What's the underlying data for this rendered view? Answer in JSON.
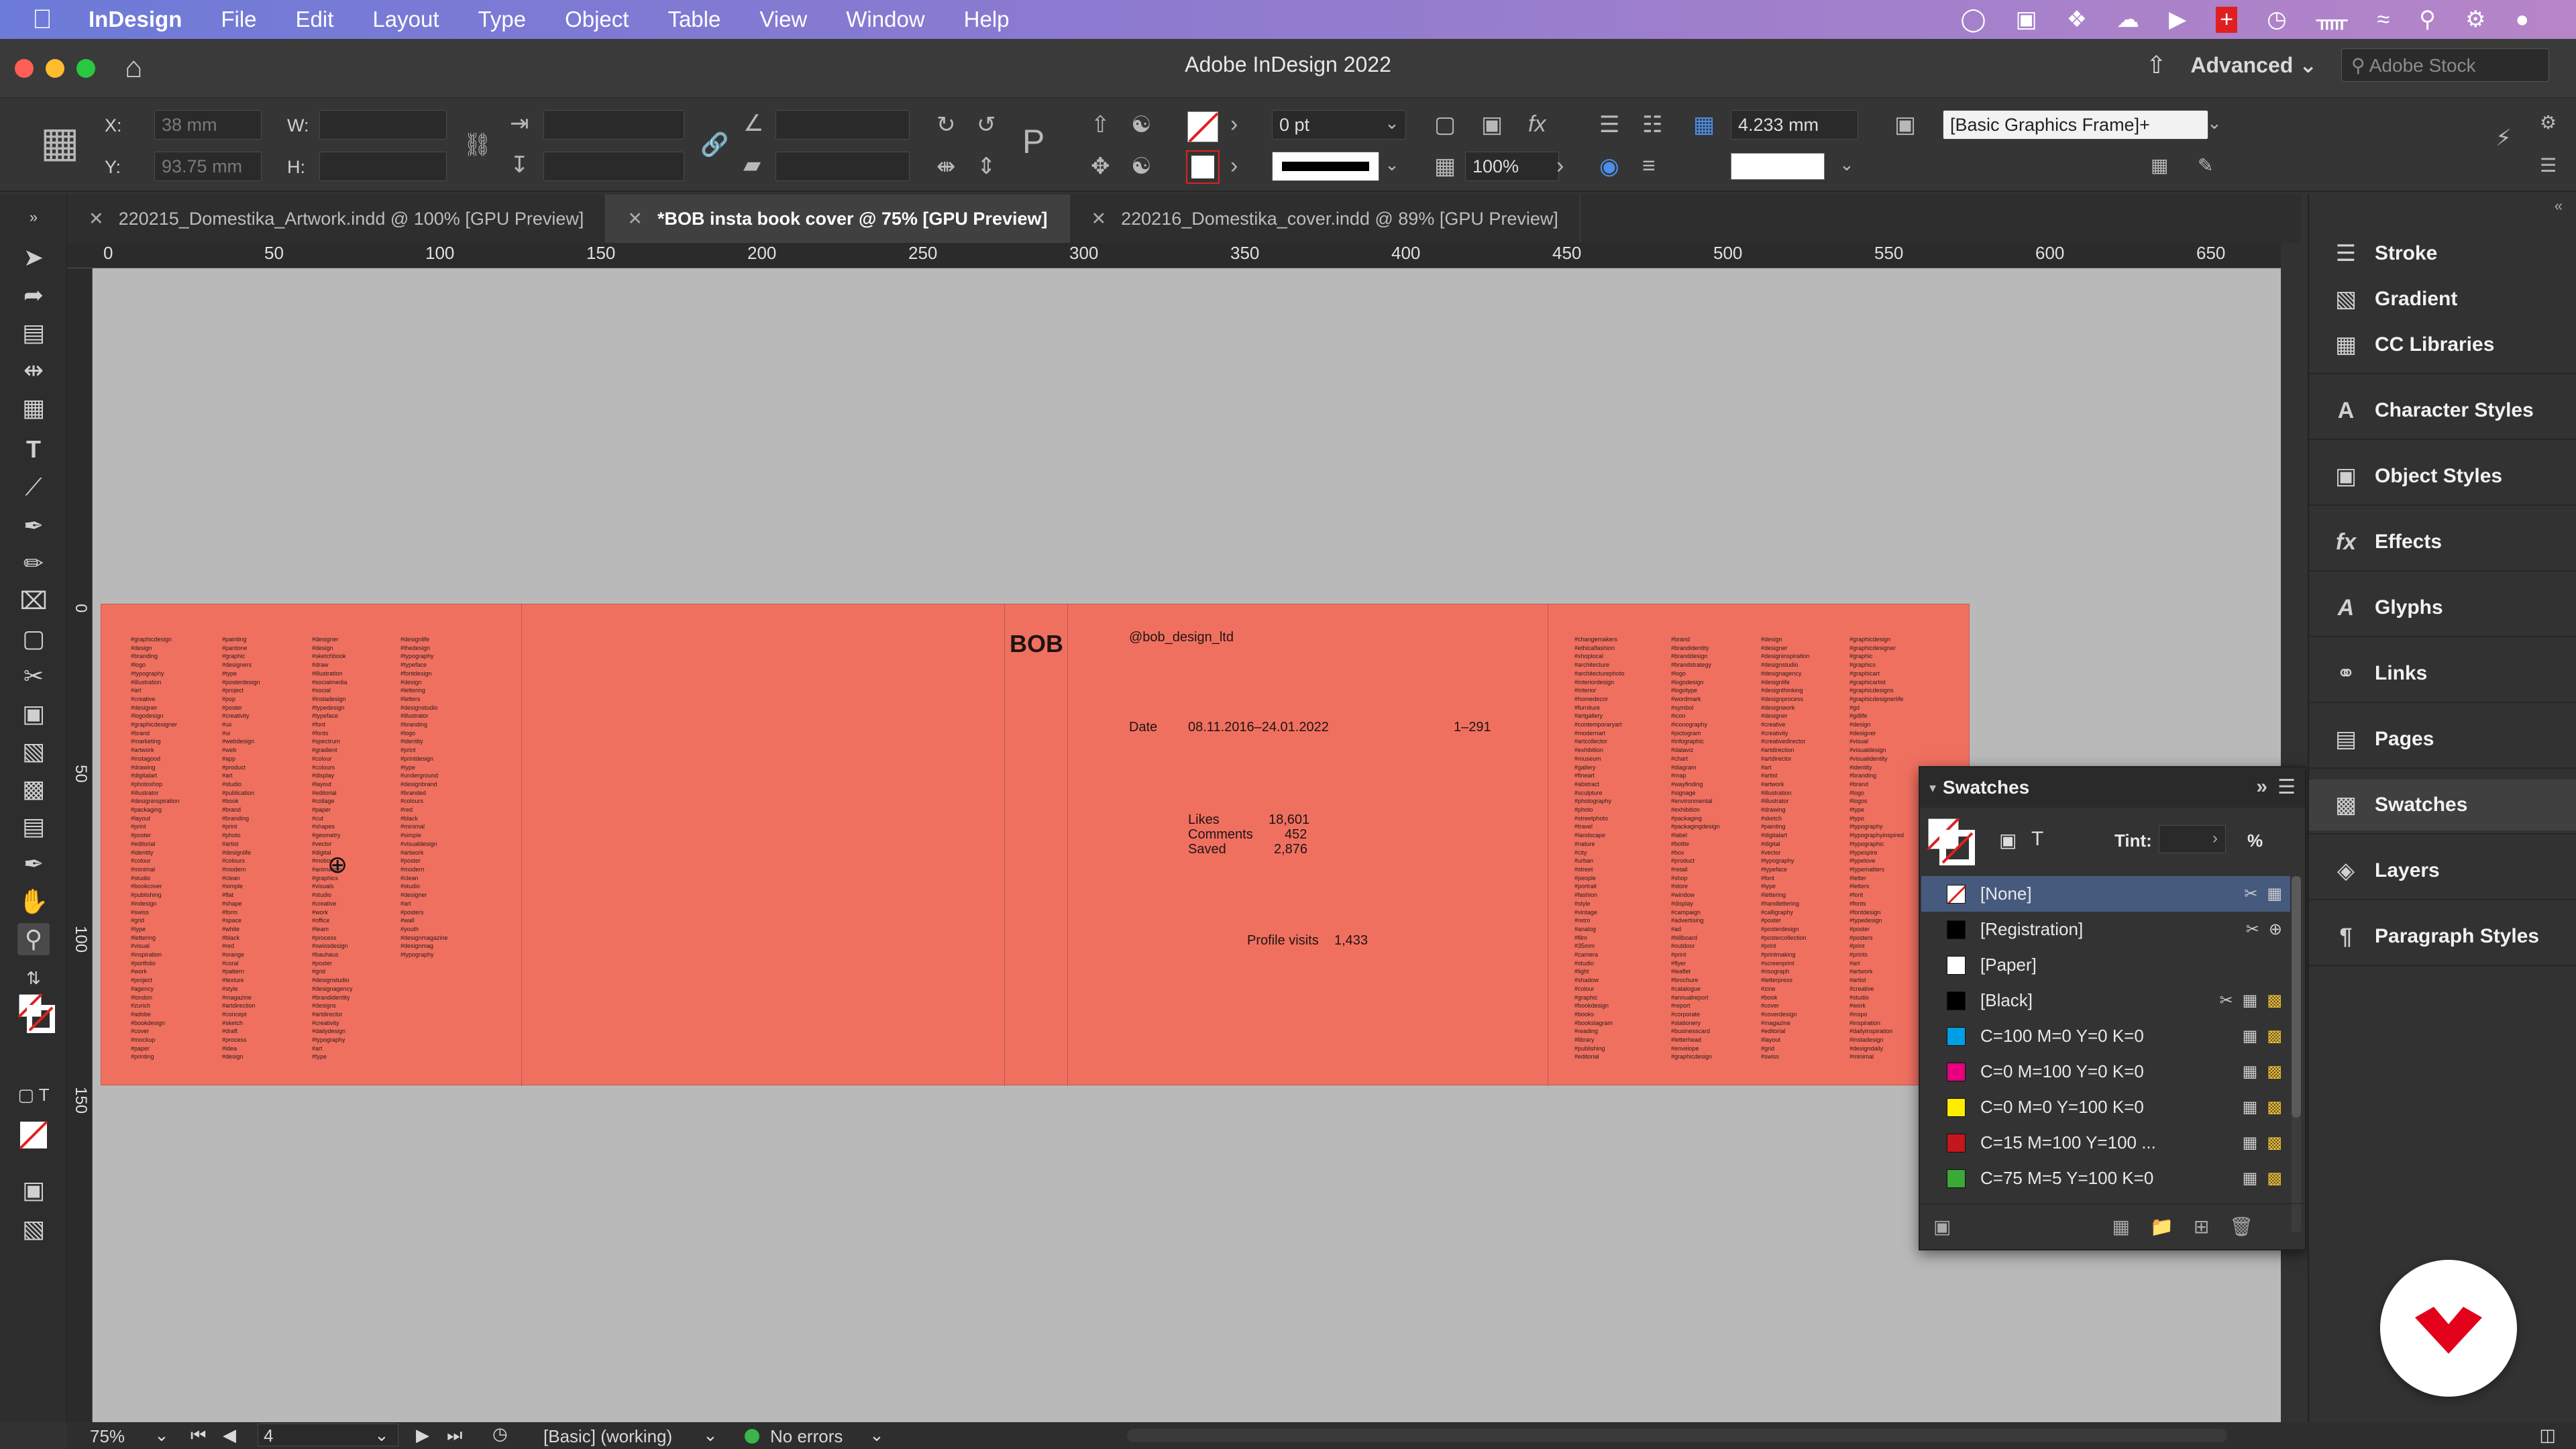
{
  "menubar": {
    "app": "InDesign",
    "items": [
      "File",
      "Edit",
      "Layout",
      "Type",
      "Object",
      "Table",
      "View",
      "Window",
      "Help"
    ]
  },
  "window": {
    "title": "Adobe InDesign 2022",
    "workspace": "Advanced",
    "stock_placeholder": "Adobe Stock"
  },
  "control": {
    "x_label": "X:",
    "x_value": "38 mm",
    "y_label": "Y:",
    "y_value": "93.75 mm",
    "w_label": "W:",
    "h_label": "H:",
    "stroke_weight": "0 pt",
    "scale": "100%",
    "spacing": "4.233 mm",
    "object_style": "[Basic Graphics Frame]+"
  },
  "tabs": [
    {
      "label": "220215_Domestika_Artwork.indd @ 100% [GPU Preview]",
      "active": false
    },
    {
      "label": "*BOB insta book cover @ 75% [GPU Preview]",
      "active": true
    },
    {
      "label": "220216_Domestika_cover.indd @ 89% [GPU Preview]",
      "active": false
    }
  ],
  "ruler": {
    "h_ticks": [
      "0",
      "50",
      "100",
      "150",
      "200",
      "250",
      "300",
      "350",
      "400",
      "450",
      "500",
      "550",
      "600",
      "650"
    ],
    "v_ticks": [
      "0",
      "50",
      "100",
      "150"
    ]
  },
  "cover": {
    "brand": "BOB",
    "handle": "@bob_design_ltd",
    "date_label": "Date",
    "date_value": "08.11.2016–24.01.2022",
    "range": "1–291",
    "likes_label": "Likes",
    "likes_value": "18,601",
    "comments_label": "Comments",
    "comments_value": "452",
    "saved_label": "Saved",
    "saved_value": "2,876",
    "visits_label": "Profile visits",
    "visits_value": "1,433"
  },
  "swatches": {
    "title": "Swatches",
    "tint_label": "Tint:",
    "tint_unit": "%",
    "items": [
      {
        "name": "[None]",
        "color": "#ffffff",
        "selected": true
      },
      {
        "name": "[Registration]",
        "color": "#000000",
        "selected": false
      },
      {
        "name": "[Paper]",
        "color": "#ffffff",
        "selected": false
      },
      {
        "name": "[Black]",
        "color": "#000000",
        "selected": false
      },
      {
        "name": "C=100 M=0 Y=0 K=0",
        "color": "#009fe3",
        "selected": false
      },
      {
        "name": "C=0 M=100 Y=0 K=0",
        "color": "#e6007e",
        "selected": false
      },
      {
        "name": "C=0 M=0 Y=100 K=0",
        "color": "#ffed00",
        "selected": false
      },
      {
        "name": "C=15 M=100 Y=100 ...",
        "color": "#c5161d",
        "selected": false
      },
      {
        "name": "C=75 M=5 Y=100 K=0",
        "color": "#3aa935",
        "selected": false
      }
    ]
  },
  "dock": {
    "items": [
      "Stroke",
      "Gradient",
      "CC Libraries",
      "Character Styles",
      "Object Styles",
      "Effects",
      "Glyphs",
      "Links",
      "Pages",
      "Swatches",
      "Layers",
      "Paragraph Styles"
    ]
  },
  "status": {
    "zoom": "75%",
    "page": "4",
    "preflight_profile": "[Basic] (working)",
    "errors": "No errors"
  },
  "colors": {
    "cover_bg": "#f07060",
    "accent_selected": "#465a7e",
    "domestika_red": "#e3001b"
  }
}
